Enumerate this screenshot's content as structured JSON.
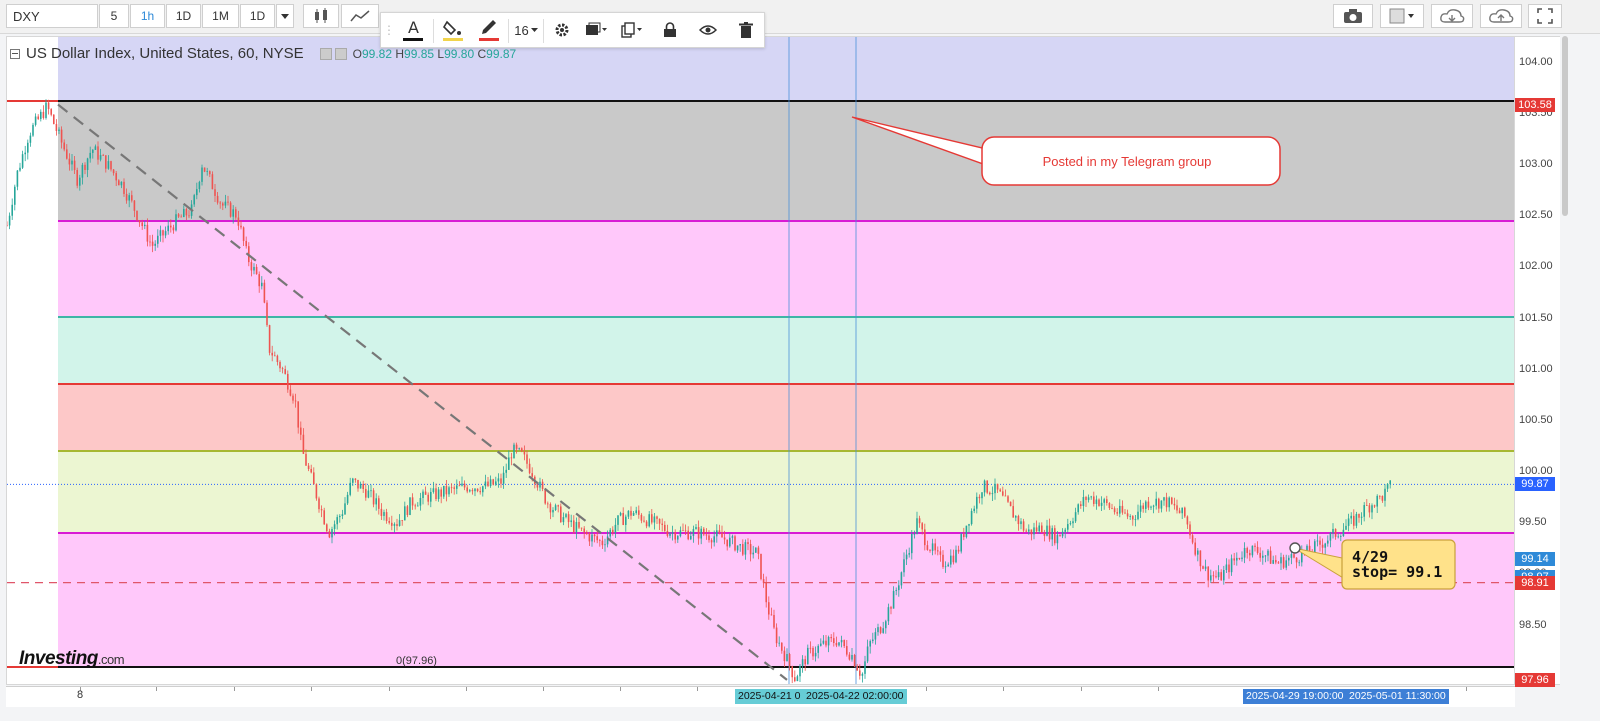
{
  "toolbar": {
    "symbol": "DXY",
    "intervals": [
      {
        "label": "5",
        "active": false
      },
      {
        "label": "1h",
        "active": true
      },
      {
        "label": "1D",
        "active": false
      },
      {
        "label": "1M",
        "active": false
      },
      {
        "label": "1D",
        "active": false
      }
    ]
  },
  "drawing_toolbar": {
    "font_size": "16"
  },
  "legend": {
    "title": "US Dollar Index, United States, 60, NYSE",
    "open_label": "O",
    "open": "99.82",
    "high_label": "H",
    "high": "99.85",
    "low_label": "L",
    "low": "99.80",
    "close_label": "C",
    "close": "99.87"
  },
  "brand": {
    "name": "Investing",
    "suffix": ".com"
  },
  "annotations": {
    "callout": "Posted in my Telegram group",
    "note_line1": "4/29",
    "note_line2": "stop= 99.1",
    "fib_label": "0(97.96)"
  },
  "colors": {
    "up": "#26a69a",
    "down": "#ef5350",
    "zone_blue": "#d6d6f5",
    "zone_gray": "#c9c9c9",
    "zone_pink": "#ffc8fa",
    "zone_teal": "#d2f4ea",
    "zone_salmon": "#fdc8c8",
    "zone_lime": "#ecf6d2",
    "line_black": "#111111",
    "line_magenta": "#d81bd4",
    "line_teal": "#3eb5a6",
    "line_red": "#e53935",
    "line_olive": "#a7b832"
  },
  "chart_data": {
    "type": "candlestick",
    "title": "US Dollar Index, United States, 60, NYSE",
    "ylim": [
      97.92,
      104.24
    ],
    "y_ticks": [
      "104.00",
      "103.50",
      "103.00",
      "102.50",
      "102.00",
      "101.50",
      "101.00",
      "100.50",
      "100.00",
      "99.50",
      "99.00",
      "98.50"
    ],
    "price_flags": [
      {
        "label": "103.58",
        "value": 103.58,
        "color": "#e53935"
      },
      {
        "label": "99.87",
        "value": 99.87,
        "color": "#2962ff"
      },
      {
        "label": "99.14",
        "value": 99.14,
        "color": "#2e8ad8"
      },
      {
        "label": "98.97",
        "value": 98.97,
        "color": "#2e8ad8"
      },
      {
        "label": "98.91",
        "value": 98.91,
        "color": "#e53935"
      },
      {
        "label": "97.96",
        "value": 97.96,
        "color": "#e53935"
      }
    ],
    "fib_levels": [
      103.58,
      102.38,
      101.44,
      100.77,
      100.1,
      99.25,
      97.96
    ],
    "stop_level": 98.91,
    "current_price": 99.87,
    "x_labels": [
      "8",
      "2025-04-21 0",
      "2025-04-22 02:00:00",
      "2025-04-29 19:00:00",
      "2025-05-01 11:30:00"
    ],
    "highlighted_dates": [
      "2025-04-21",
      "2025-04-22"
    ],
    "trendline": {
      "from": 103.58,
      "to": 97.96
    },
    "price_path": [
      [
        0,
        102.4
      ],
      [
        10,
        102.9
      ],
      [
        22,
        103.3
      ],
      [
        40,
        103.56
      ],
      [
        55,
        103.2
      ],
      [
        70,
        102.85
      ],
      [
        85,
        103.15
      ],
      [
        100,
        103.0
      ],
      [
        115,
        102.8
      ],
      [
        128,
        102.55
      ],
      [
        145,
        102.2
      ],
      [
        160,
        102.35
      ],
      [
        170,
        102.45
      ],
      [
        185,
        102.55
      ],
      [
        195,
        103.0
      ],
      [
        205,
        102.8
      ],
      [
        215,
        102.6
      ],
      [
        230,
        102.5
      ],
      [
        240,
        102.1
      ],
      [
        255,
        101.8
      ],
      [
        262,
        101.2
      ],
      [
        275,
        101.0
      ],
      [
        288,
        100.7
      ],
      [
        295,
        100.2
      ],
      [
        305,
        99.9
      ],
      [
        315,
        99.6
      ],
      [
        322,
        99.4
      ],
      [
        335,
        99.6
      ],
      [
        345,
        99.9
      ],
      [
        360,
        99.8
      ],
      [
        375,
        99.6
      ],
      [
        390,
        99.5
      ],
      [
        405,
        99.7
      ],
      [
        420,
        99.75
      ],
      [
        440,
        99.8
      ],
      [
        460,
        99.85
      ],
      [
        480,
        99.85
      ],
      [
        495,
        99.9
      ],
      [
        505,
        100.2
      ],
      [
        515,
        100.15
      ],
      [
        525,
        100.0
      ],
      [
        540,
        99.7
      ],
      [
        555,
        99.55
      ],
      [
        575,
        99.4
      ],
      [
        595,
        99.3
      ],
      [
        610,
        99.5
      ],
      [
        625,
        99.6
      ],
      [
        645,
        99.5
      ],
      [
        665,
        99.4
      ],
      [
        690,
        99.4
      ],
      [
        715,
        99.35
      ],
      [
        735,
        99.25
      ],
      [
        750,
        99.2
      ],
      [
        760,
        98.7
      ],
      [
        768,
        98.4
      ],
      [
        778,
        98.2
      ],
      [
        788,
        97.98
      ],
      [
        800,
        98.2
      ],
      [
        815,
        98.3
      ],
      [
        830,
        98.35
      ],
      [
        845,
        98.2
      ],
      [
        855,
        98.0
      ],
      [
        862,
        98.3
      ],
      [
        875,
        98.5
      ],
      [
        888,
        98.8
      ],
      [
        900,
        99.2
      ],
      [
        910,
        99.5
      ],
      [
        920,
        99.3
      ],
      [
        935,
        99.1
      ],
      [
        950,
        99.2
      ],
      [
        960,
        99.5
      ],
      [
        975,
        99.85
      ],
      [
        990,
        99.8
      ],
      [
        1005,
        99.6
      ],
      [
        1020,
        99.4
      ],
      [
        1035,
        99.45
      ],
      [
        1050,
        99.35
      ],
      [
        1065,
        99.55
      ],
      [
        1080,
        99.75
      ],
      [
        1095,
        99.7
      ],
      [
        1110,
        99.6
      ],
      [
        1125,
        99.55
      ],
      [
        1140,
        99.7
      ],
      [
        1160,
        99.7
      ],
      [
        1178,
        99.55
      ],
      [
        1190,
        99.2
      ],
      [
        1200,
        99.0
      ],
      [
        1212,
        98.95
      ],
      [
        1225,
        99.1
      ],
      [
        1240,
        99.25
      ],
      [
        1255,
        99.2
      ],
      [
        1270,
        99.1
      ],
      [
        1285,
        99.15
      ],
      [
        1300,
        99.2
      ],
      [
        1315,
        99.3
      ],
      [
        1330,
        99.4
      ],
      [
        1345,
        99.5
      ],
      [
        1360,
        99.65
      ],
      [
        1375,
        99.75
      ],
      [
        1385,
        99.87
      ]
    ]
  }
}
